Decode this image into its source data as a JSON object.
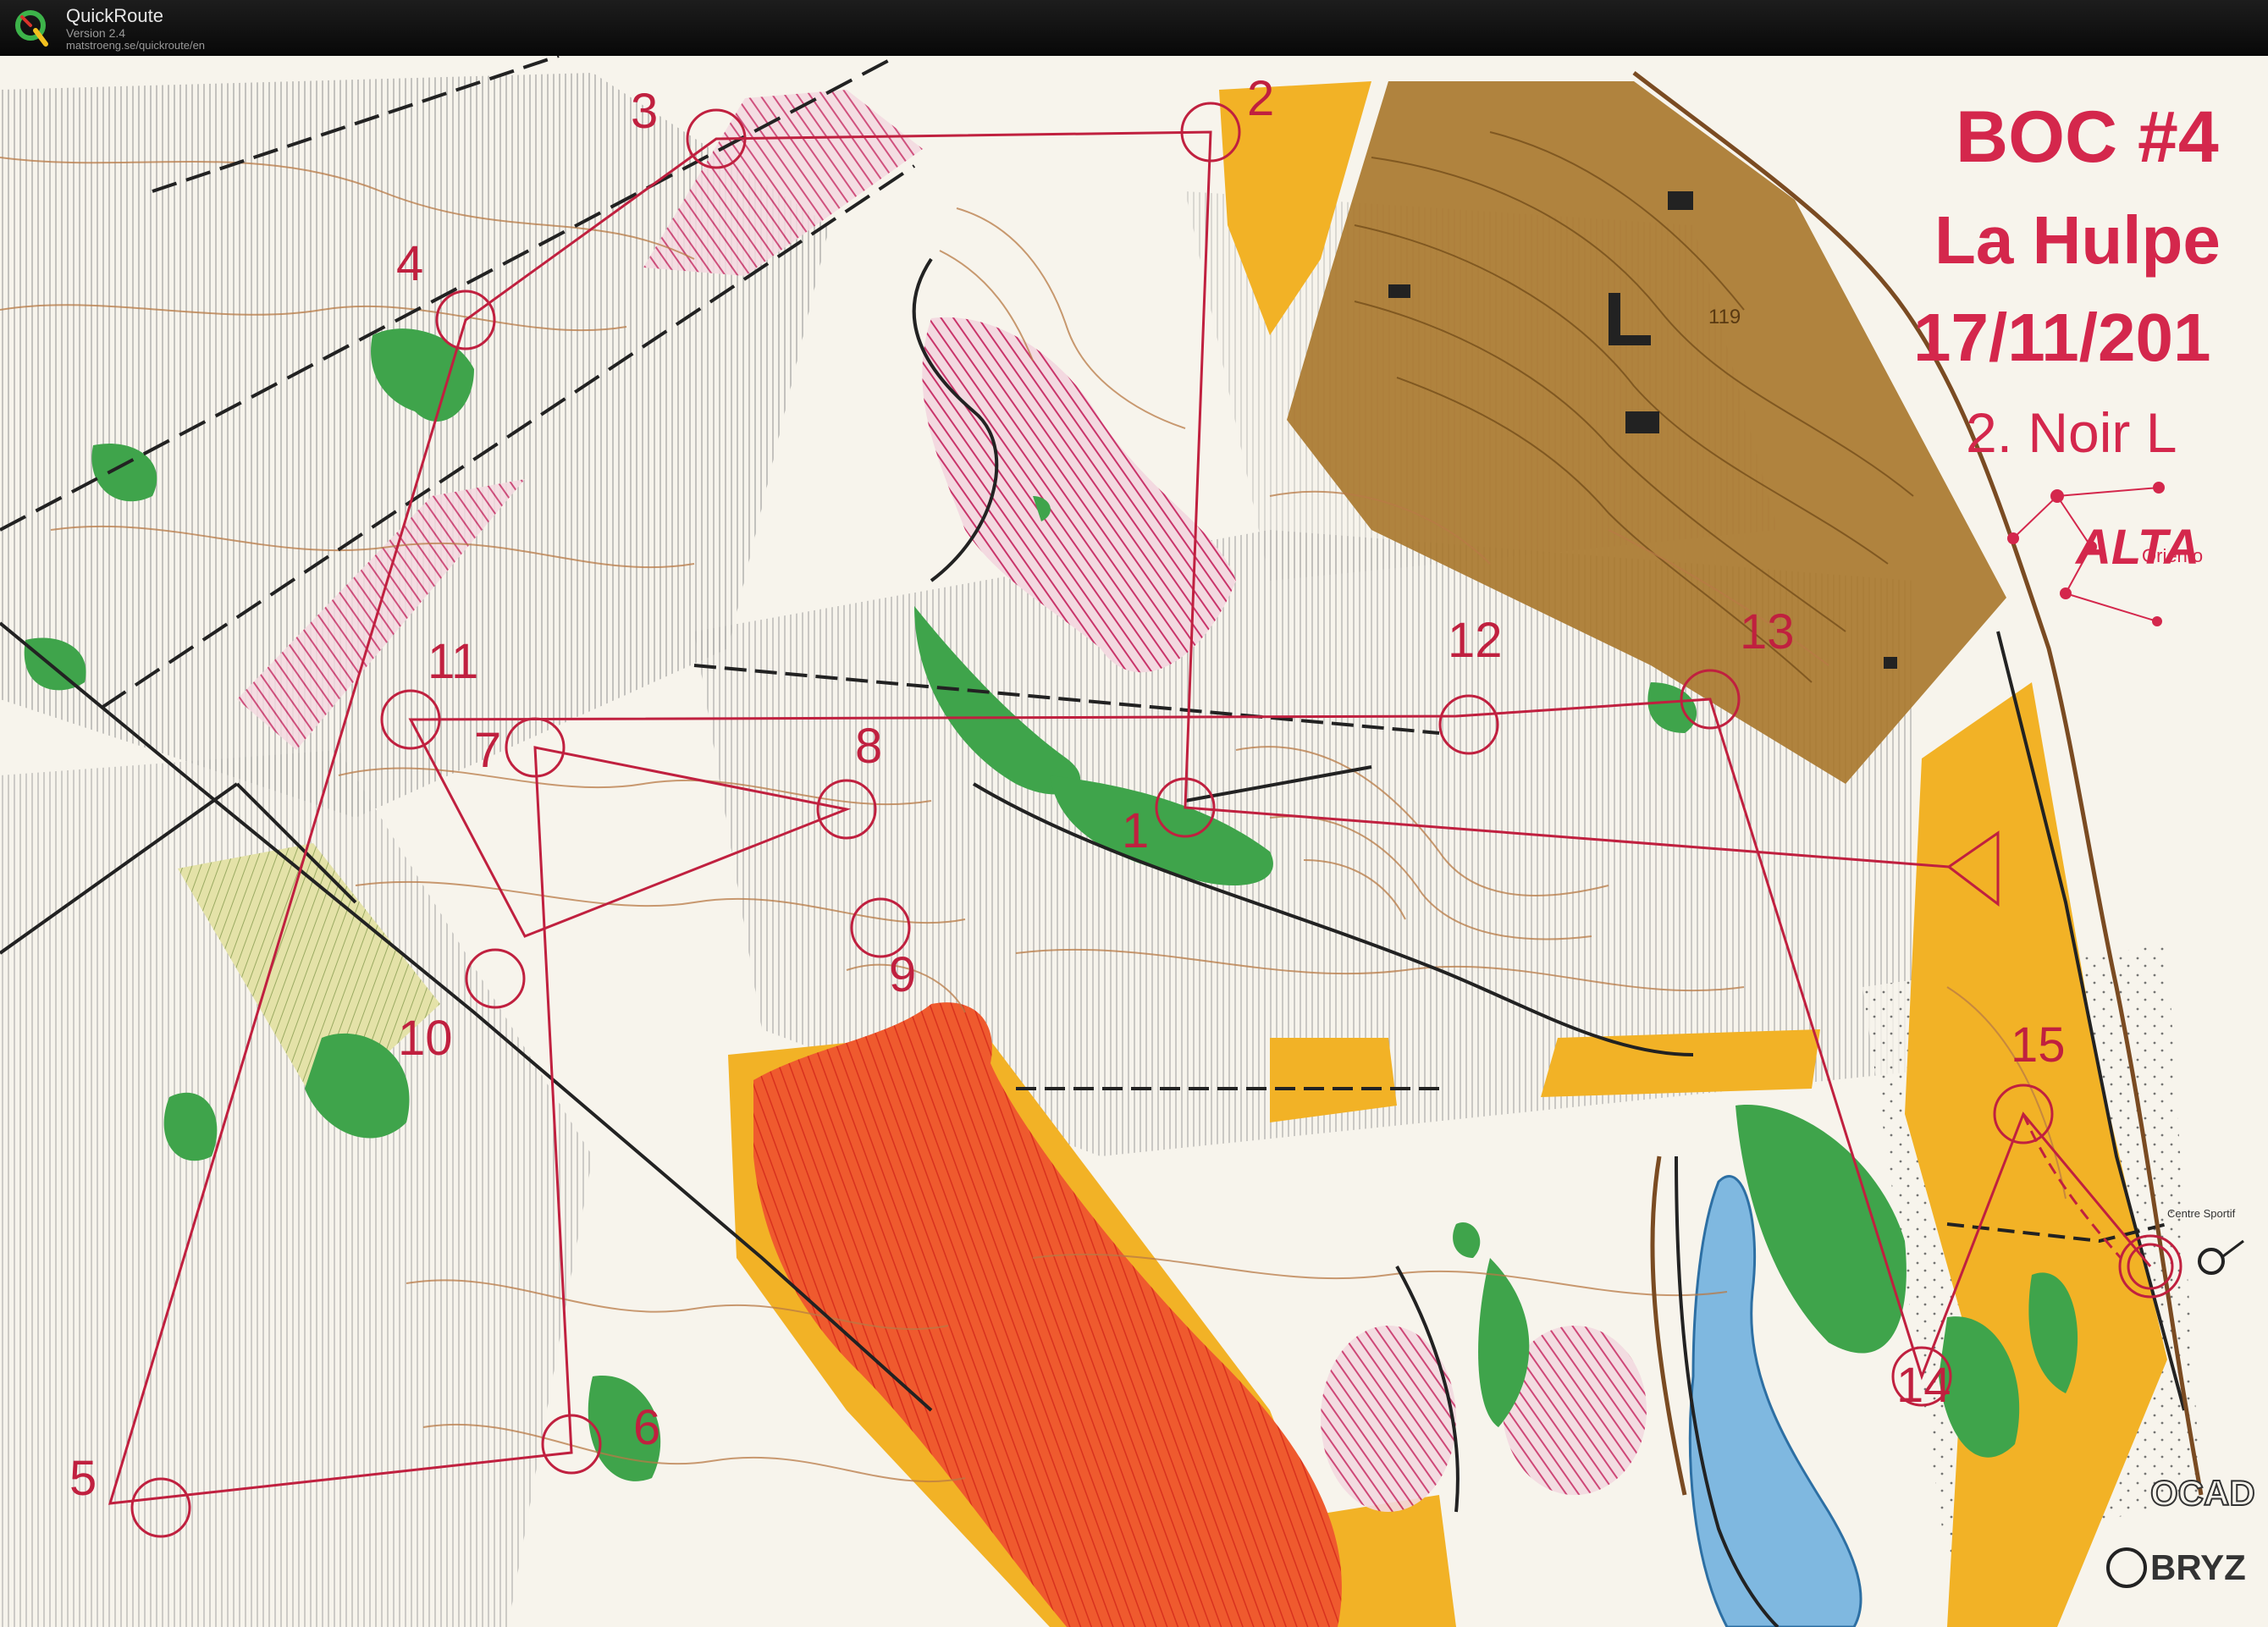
{
  "app": {
    "name": "QuickRoute",
    "version": "Version 2.4",
    "url": "matstroeng.se/quickroute/en"
  },
  "map_header": {
    "event": "BOC #4",
    "place": "La Hulpe",
    "date": "17/11/201",
    "course": "2. Noir L",
    "club_logo": "ALTA",
    "club_sub": "Oriento"
  },
  "sponsors": [
    "OCAD",
    "BRYZ"
  ],
  "map_annotations": {
    "height_label": "119",
    "road_label": "Centre Sportif"
  },
  "course": {
    "color": "#c0203f",
    "controls": [
      {
        "label": "1"
      },
      {
        "label": "2"
      },
      {
        "label": "3"
      },
      {
        "label": "4"
      },
      {
        "label": "5"
      },
      {
        "label": "6"
      },
      {
        "label": "7"
      },
      {
        "label": "8"
      },
      {
        "label": "9"
      },
      {
        "label": "10"
      },
      {
        "label": "11"
      },
      {
        "label": "12"
      },
      {
        "label": "13"
      },
      {
        "label": "14"
      },
      {
        "label": "15"
      }
    ]
  },
  "colors": {
    "paper": "#f7f4ec",
    "contour": "#b87a45",
    "green": "#3fa44b",
    "yellow": "#f2b226",
    "olive": "#d9d98a",
    "private": "#a9782f",
    "out_of_bounds_red": "#e9482a",
    "out_of_bounds_pink": "#d1396a",
    "water": "#7fb8e0",
    "titlebar": "#0f0f0f"
  }
}
